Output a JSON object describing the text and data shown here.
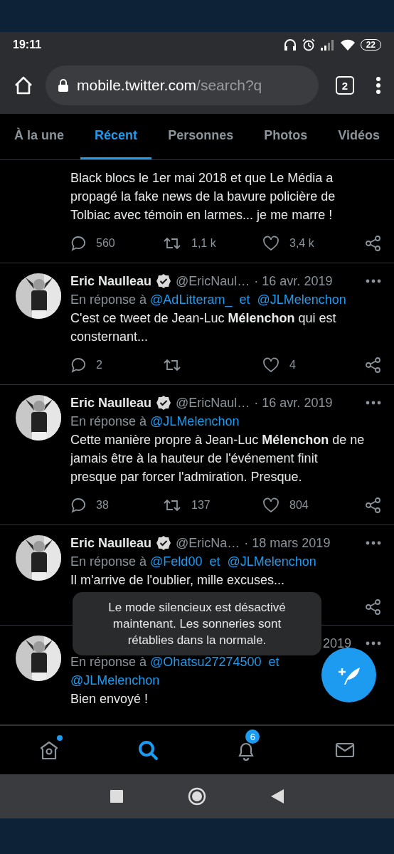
{
  "status_bar": {
    "time": "19:11",
    "battery": "22"
  },
  "browser": {
    "url_host": "mobile.twitter.com",
    "url_path": "/search?q",
    "tab_count": "2"
  },
  "tabs": [
    {
      "label": "À la une",
      "selected": false
    },
    {
      "label": "Récent",
      "selected": true
    },
    {
      "label": "Personnes",
      "selected": false
    },
    {
      "label": "Photos",
      "selected": false
    },
    {
      "label": "Vidéos",
      "selected": false
    }
  ],
  "tweets": [
    {
      "text": "Black blocs le 1er mai 2018 et que Le Média a propagé la fake news de la bavure policière de Tolbiac avec témoin en larmes... je me marre !",
      "kind": "full",
      "replies": "560",
      "retweets": "1,1 k",
      "likes": "3,4 k"
    },
    {
      "author": "Eric Naulleau",
      "verified": true,
      "handle": "@EricNaul…",
      "date": "· 16 avr. 2019",
      "reply_prefix": "En réponse à",
      "reply_to": [
        "@AdLitteram_",
        "@JLMelenchon"
      ],
      "joiner": "et",
      "text": "C'est ce tweet de Jean-Luc **Mélenchon** qui est consternant...",
      "kind": "full",
      "replies": "2",
      "likes": "4"
    },
    {
      "author": "Eric Naulleau",
      "verified": true,
      "handle": "@EricNaul…",
      "date": "· 16 avr. 2019",
      "reply_prefix": "En réponse à",
      "reply_to": [
        "@JLMelenchon"
      ],
      "text": "Cette manière propre à Jean-Luc **Mélenchon** de ne jamais être à la hauteur de l'événement finit presque par forcer l'admiration. Presque.",
      "kind": "full",
      "replies": "38",
      "retweets": "137",
      "likes": "804"
    },
    {
      "author": "Eric Naulleau",
      "verified": true,
      "handle": "@EricNa…",
      "date": "· 18 mars 2019",
      "reply_prefix": "En réponse à",
      "reply_to": [
        "@Feld00",
        "@JLMelenchon"
      ],
      "joiner": "et",
      "text": "Il m'arrive de l'oublier, mille excuses...",
      "kind": "share_only"
    },
    {
      "date": "2019",
      "reply_prefix": "En réponse à",
      "reply_to": [
        "@Ohatsu27274500",
        "@JLMelenchon"
      ],
      "joiner": "et",
      "text": "Bien envoyé !",
      "kind": "plain"
    }
  ],
  "toast": {
    "text": "Le mode silencieux est désactivé maintenant. Les sonneries sont rétablies dans la normale."
  },
  "bottom_nav": [
    {
      "kind": "home",
      "selected": false,
      "dot": true
    },
    {
      "kind": "search",
      "selected": true
    },
    {
      "kind": "notifications",
      "selected": false,
      "badge": "6"
    },
    {
      "kind": "messages",
      "selected": false
    }
  ]
}
